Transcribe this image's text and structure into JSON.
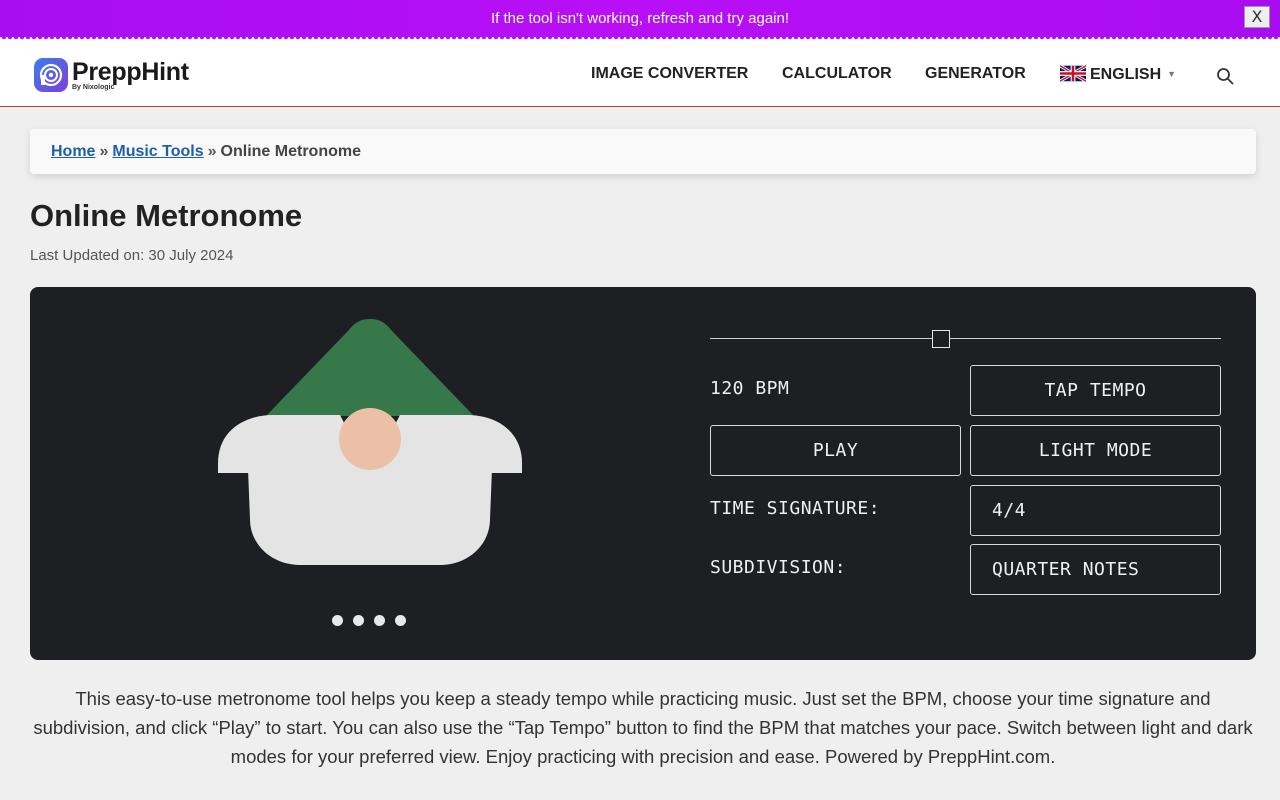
{
  "banner": {
    "message": "If the tool isn't working, refresh and try again!",
    "close_label": "X"
  },
  "header": {
    "logo_name": "PreppHint",
    "logo_byline": "By Nixologic",
    "nav": [
      {
        "label": "IMAGE CONVERTER"
      },
      {
        "label": "CALCULATOR"
      },
      {
        "label": "GENERATOR"
      }
    ],
    "language": {
      "label": "ENGLISH",
      "flag": "uk-flag-icon"
    },
    "search_icon": "search-icon"
  },
  "breadcrumb": {
    "home": "Home",
    "separator": "»",
    "music_tools": "Music Tools",
    "current": "Online Metronome"
  },
  "page": {
    "title": "Online Metronome",
    "last_updated": "Last Updated on: 30 July 2024"
  },
  "metronome": {
    "tempo_slider_fraction": 0.45,
    "bpm_display": "120 BPM",
    "tap_tempo_label": "TAP TEMPO",
    "play_label": "PLAY",
    "light_mode_label": "LIGHT MODE",
    "time_signature_label": "TIME SIGNATURE:",
    "time_signature_value": "4/4",
    "subdivision_label": "SUBDIVISION:",
    "subdivision_value": "QUARTER NOTES",
    "beat_count": 4,
    "colors": {
      "panel": "#1e1f23",
      "hat": "#37784a",
      "beard": "#e4e4e4",
      "nose": "#ecc0a6"
    }
  },
  "description": "This easy-to-use metronome tool helps you keep a steady tempo while practicing music. Just set the BPM, choose your time signature and subdivision, and click “Play” to start. You can also use the “Tap Tempo” button to find the BPM that matches your pace. Switch between light and dark modes for your preferred view. Enjoy practicing with precision and ease. Powered by PreppHint.com."
}
